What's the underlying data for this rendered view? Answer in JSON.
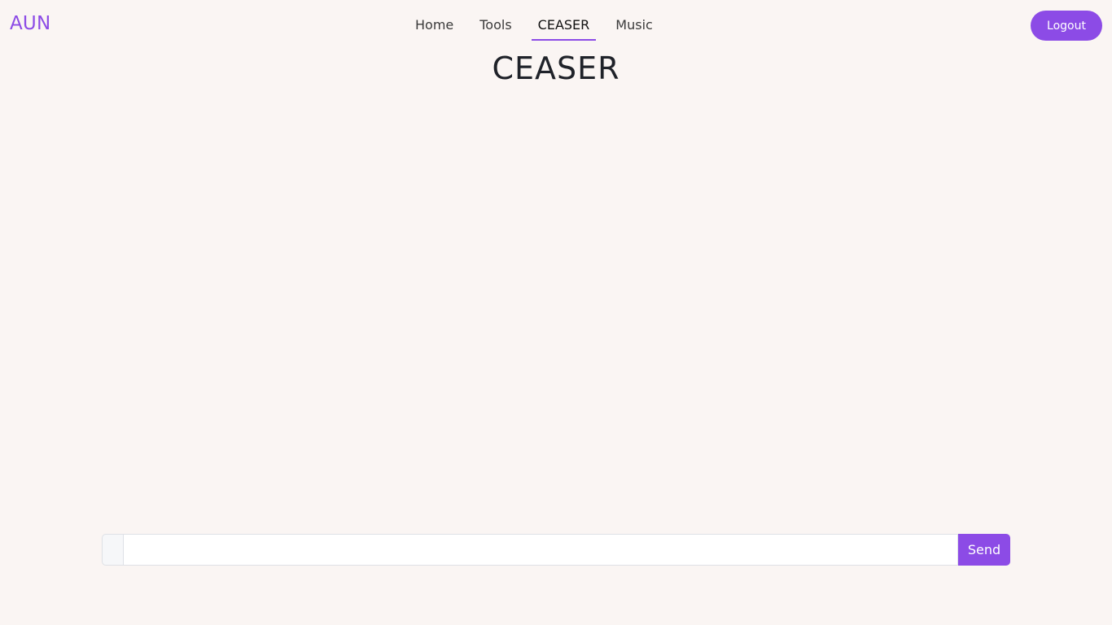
{
  "navbar": {
    "brand": "AUN",
    "links": [
      {
        "label": "Home",
        "active": false
      },
      {
        "label": "Tools",
        "active": false
      },
      {
        "label": "CEASER",
        "active": true
      },
      {
        "label": "Music",
        "active": false
      }
    ],
    "logout_label": "Logout"
  },
  "main": {
    "title": "CEASER"
  },
  "composer": {
    "input_value": "",
    "send_label": "Send"
  },
  "colors": {
    "accent": "#8c4be6",
    "background": "#faf5f3",
    "title": "#1f2229"
  }
}
